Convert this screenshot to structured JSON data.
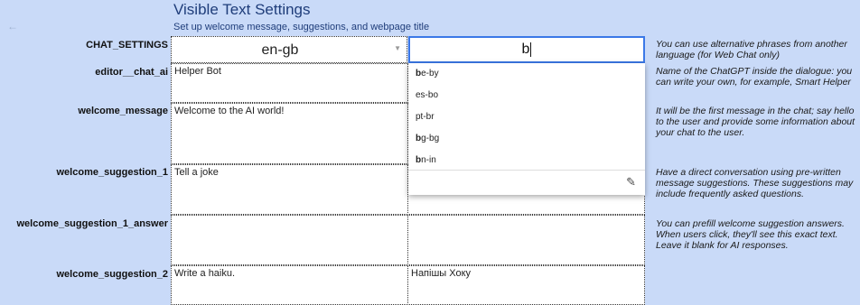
{
  "header": {
    "title": "Visible Text Settings",
    "subtitle": "Set up welcome message, suggestions, and webpage title",
    "back_icon": "←"
  },
  "rows": [
    {
      "label": "CHAT_SETTINGS",
      "value": "en-gb",
      "translation": "b",
      "note": "You can use alternative phrases from another language (for Web Chat only)"
    },
    {
      "label": "editor__chat_ai",
      "value": "Helper Bot",
      "translation": "",
      "note": "Name of the ChatGPT inside the dialogue: you can write your own, for example, Smart Helper"
    },
    {
      "label": "welcome_message",
      "value": "Welcome to the AI world!",
      "translation": "",
      "note": "It will be the first message in the chat; say hello to the user and provide some information about your chat to the user."
    },
    {
      "label": "welcome_suggestion_1",
      "value": "Tell a joke",
      "translation": "",
      "note": "Have a direct conversation using pre-written message suggestions. These suggestions may include frequently asked questions."
    },
    {
      "label": "welcome_suggestion_1_answer",
      "value": "",
      "translation": "",
      "note": "You can prefill welcome suggestion answers. When users click, they'll see this exact text. Leave it blank for AI responses."
    },
    {
      "label": "welcome_suggestion_2",
      "value": "Write a haiku.",
      "translation": "Напішы Хоку",
      "note": ""
    }
  ],
  "dropdown": {
    "options": [
      {
        "prefix": "b",
        "rest": "e-by"
      },
      {
        "prefix": "",
        "rest": "es-bo"
      },
      {
        "prefix": "",
        "rest": "pt-br"
      },
      {
        "prefix": "b",
        "rest": "g-bg"
      },
      {
        "prefix": "b",
        "rest": "n-in"
      }
    ],
    "edit_icon": "pencil-icon"
  }
}
